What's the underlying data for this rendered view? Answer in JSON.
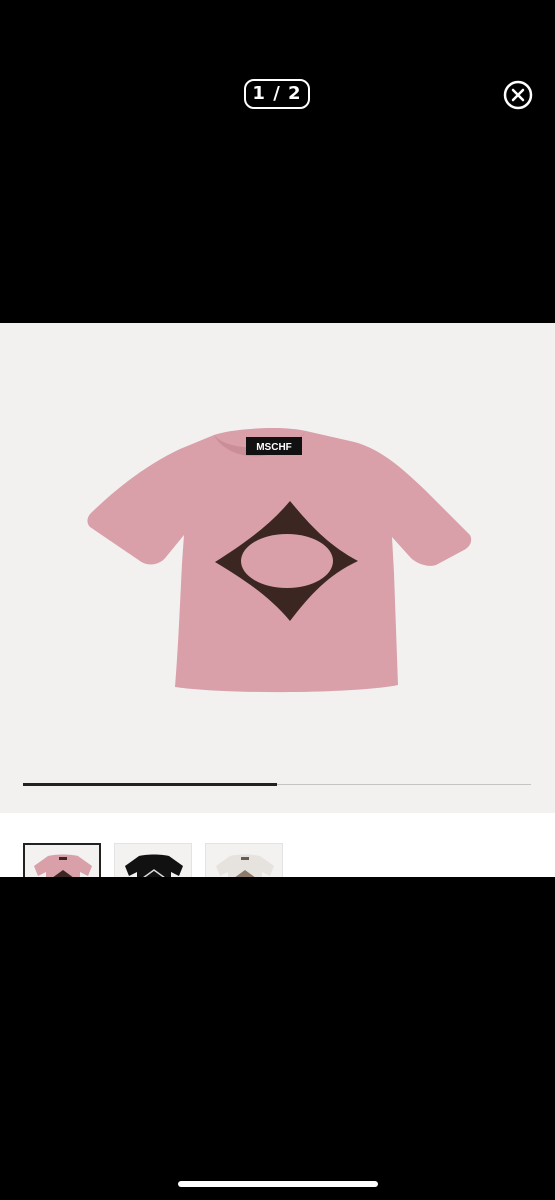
{
  "viewer": {
    "counter_text": "1 / 2",
    "progress_fraction": 0.5
  },
  "product": {
    "label_text": "MSCHF",
    "shirt_color": "#d9a0a9",
    "graphic_color": "#3b2622"
  },
  "thumbnails": [
    {
      "color": "#d9a0a9",
      "selected": true
    },
    {
      "color": "#111111",
      "selected": false
    },
    {
      "color": "#e6e3de",
      "selected": false
    }
  ],
  "colors": {
    "background": "#000000",
    "viewer_bg": "#f2f1f0",
    "progress_fill": "#222222",
    "progress_track": "#c4c4c4"
  },
  "icons": {
    "close": "close-circle-icon"
  }
}
